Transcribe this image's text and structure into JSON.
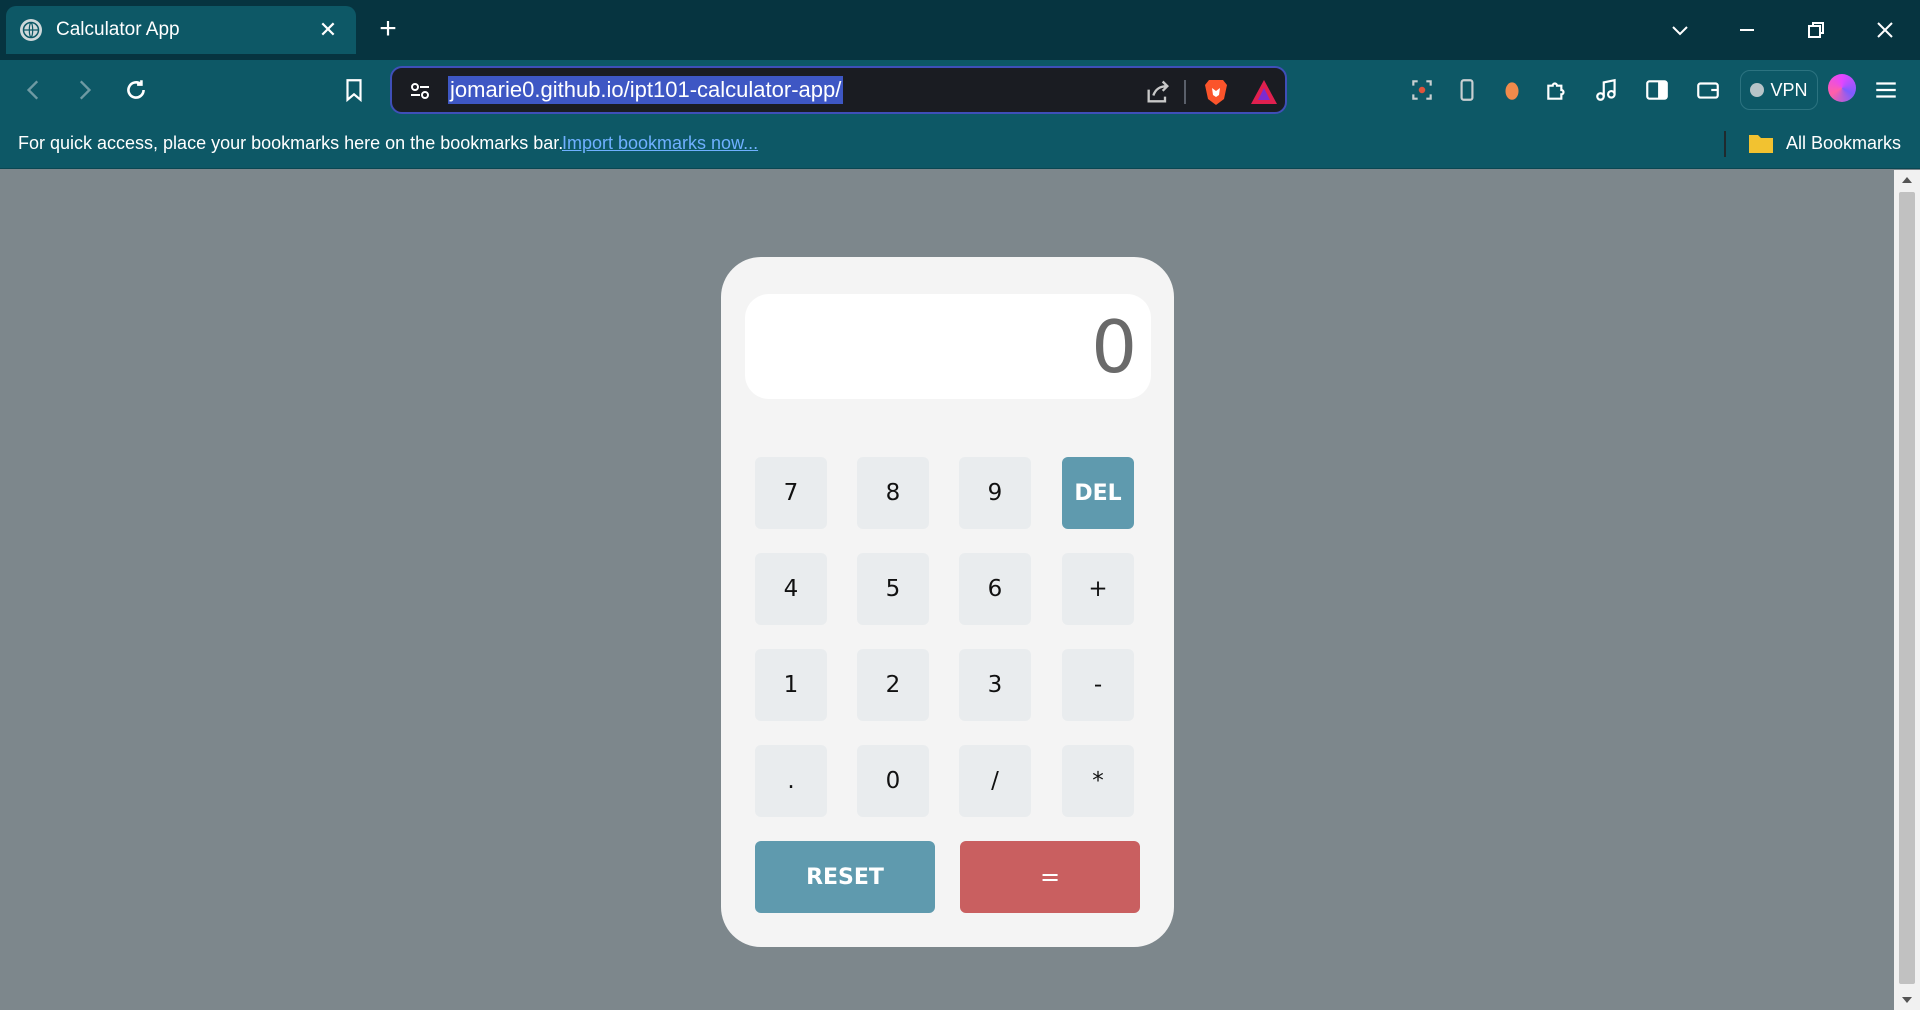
{
  "browser": {
    "tab": {
      "title": "Calculator App",
      "close_label": "✕"
    },
    "new_tab_label": "+",
    "address": {
      "url": "jomarie0.github.io/ipt101-calculator-app/"
    },
    "vpn_label": "VPN",
    "bookmarks_bar": {
      "message": "For quick access, place your bookmarks here on the bookmarks bar.",
      "import_link": "Import bookmarks now...",
      "all_bookmarks": "All Bookmarks"
    }
  },
  "calculator": {
    "display": "0",
    "keys": {
      "k7": "7",
      "k8": "8",
      "k9": "9",
      "del": "DEL",
      "k4": "4",
      "k5": "5",
      "k6": "6",
      "plus": "+",
      "k1": "1",
      "k2": "2",
      "k3": "3",
      "minus": "-",
      "dot": ".",
      "k0": "0",
      "divide": "/",
      "multiply": "*",
      "reset": "RESET",
      "equals": "="
    }
  },
  "colors": {
    "page_background": "#7d878c",
    "accent_blue": "#5f9aae",
    "accent_red": "#c95f60",
    "browser_chrome": "#0d5866"
  }
}
